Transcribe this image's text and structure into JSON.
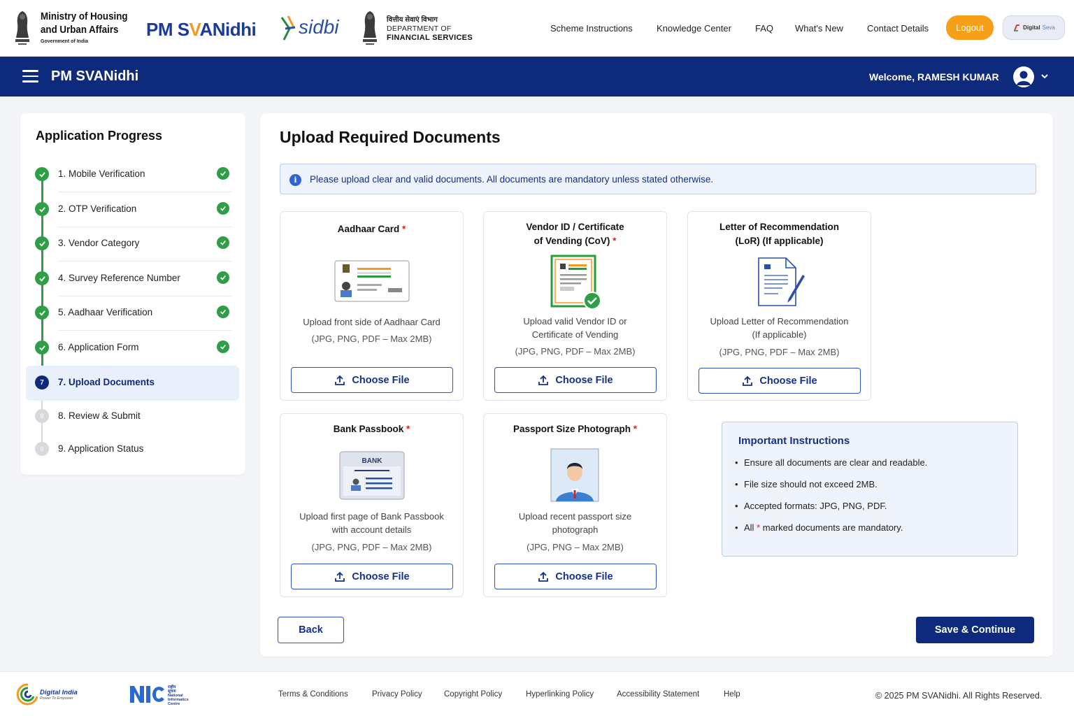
{
  "header": {
    "ministry_line1": "Ministry of Housing",
    "ministry_line2": "and Urban Affairs",
    "ministry_line3": "Government of India",
    "brand_prefix": "PM S",
    "brand_mid": "V",
    "brand_suffix": "ANidhi",
    "sidbi": "sidbi",
    "dfs_hindi": "वित्तीय सेवाएं विभाग",
    "dfs_line1": "DEPARTMENT OF",
    "dfs_line2": "FINANCIAL SERVICES",
    "nav": [
      "Scheme Instructions",
      "Knowledge Center",
      "FAQ",
      "What's New",
      "Contact Details"
    ],
    "logout_label": "Logout",
    "digitalseva_a": "Digital",
    "digitalseva_b": "Seva"
  },
  "appbar": {
    "title": "PM SVANidhi",
    "welcome": "Welcome, RAMESH KUMAR"
  },
  "sidebar": {
    "title": "Application Progress",
    "steps": [
      {
        "label": "1. Mobile Verification",
        "status": "done"
      },
      {
        "label": "2. OTP Verification",
        "status": "done"
      },
      {
        "label": "3. Vendor Category",
        "status": "done"
      },
      {
        "label": "4. Survey Reference Number",
        "status": "done"
      },
      {
        "label": "5. Aadhaar Verification",
        "status": "done"
      },
      {
        "label": "6. Application Form",
        "status": "done"
      },
      {
        "label": "7. Upload Documents",
        "status": "active",
        "num": "7"
      },
      {
        "label": "8. Review & Submit",
        "status": "pending",
        "num": "8"
      },
      {
        "label": "9. Application Status",
        "status": "pending",
        "num": "9"
      }
    ]
  },
  "main": {
    "title": "Upload Required Documents",
    "banner": "Please upload clear and valid documents. All documents are mandatory unless stated otherwise.",
    "choose_label": "Choose File",
    "documents": [
      {
        "title": "Aadhaar Card",
        "required": "*",
        "desc": "Upload front side of Aadhaar Card",
        "formats": "(JPG, PNG, PDF – Max 2MB)"
      },
      {
        "title_l1": "Vendor ID / Certificate",
        "title_l2": "of Vending (CoV)",
        "required": "*",
        "desc_l1": "Upload valid Vendor ID or",
        "desc_l2": "Certificate of Vending",
        "formats": "(JPG, PNG, PDF – Max 2MB)"
      },
      {
        "title_l1": "Letter of Recommendation",
        "title_l2": "(LoR) (If applicable)",
        "desc_l1": "Upload Letter of Recommendation",
        "desc_l2": "(If applicable)",
        "formats": "(JPG, PNG, PDF – Max 2MB)"
      },
      {
        "title": "Bank Passbook",
        "required": "*",
        "desc_l1": "Upload first page of Bank Passbook",
        "desc_l2": "with account details",
        "formats": "(JPG, PNG, PDF – Max 2MB)",
        "bank_word": "BANK"
      },
      {
        "title": "Passport Size Photograph",
        "required": "*",
        "desc_l1": "Upload recent passport size",
        "desc_l2": "photograph",
        "formats": "(JPG, PNG – Max 2MB)"
      }
    ],
    "instructions": {
      "title": "Important Instructions",
      "items": [
        "Ensure all documents are clear and readable.",
        "File size should not exceed 2MB.",
        "Accepted formats: JPG, PNG, PDF."
      ],
      "last_prefix": "All",
      "last_star": "*",
      "last_suffix": "marked documents are mandatory."
    },
    "back_label": "Back",
    "save_label": "Save & Continue"
  },
  "footer": {
    "digital_india": "Digital India",
    "digital_india_tag": "Power To Empower",
    "nic_l1": "राष्ट्रीय",
    "nic_l2": "सूचना",
    "nic_l3": "National",
    "nic_l4": "Informatics",
    "nic_l5": "Centre",
    "links": [
      "Terms & Conditions",
      "Privacy Policy",
      "Copyright Policy",
      "Hyperlinking Policy",
      "Accessibility Statement",
      "Help"
    ],
    "copyright": "© 2025 PM SVANidhi. All Rights Reserved."
  },
  "colors": {
    "primary": "#0d2a7c",
    "accent": "#f6a01a",
    "success": "#2f9e47",
    "required": "#dd2222"
  }
}
